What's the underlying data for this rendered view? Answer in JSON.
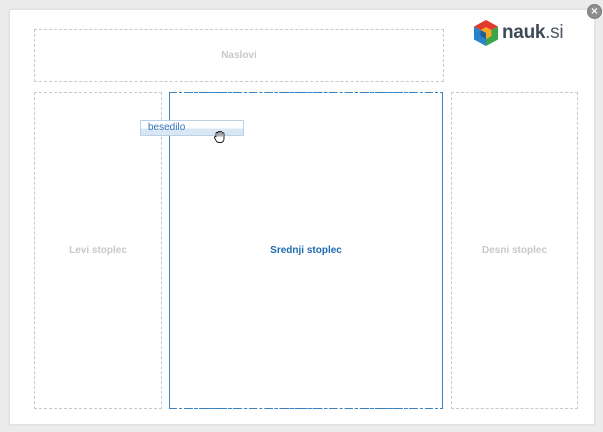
{
  "dialog": {
    "close_label": "×"
  },
  "logo": {
    "name": "nauk",
    "tld": ".si",
    "icon": "nauk-cube-logo-icon",
    "colors": [
      "#e2392d",
      "#f5a623",
      "#2a82c9",
      "#3aa54b"
    ]
  },
  "layout": {
    "title_zone": "Naslovi",
    "left_column": "Levi stoplec",
    "center_column": "Srednji stoplec",
    "right_column": "Desni stoplec"
  },
  "drag": {
    "label": "besedilo",
    "cursor": "grab-hand-icon"
  },
  "colors": {
    "active_zone": "#3b82c0",
    "inactive_zone": "#c9c9c9",
    "active_text": "#1e6bb0",
    "inactive_text": "#c8c8c8"
  }
}
